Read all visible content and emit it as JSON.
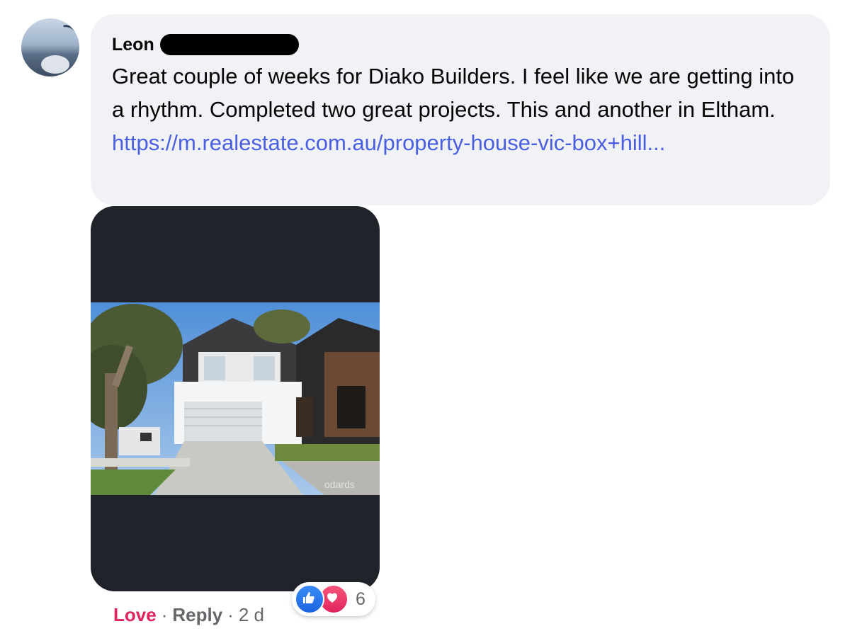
{
  "comment": {
    "author": "Leon",
    "text": "Great couple of weeks for Diako Builders. I feel like we are getting into a rhythm. Completed two great projects. This and another in Eltham.",
    "link": "https://m.realestate.com.au/property-house-vic-box+hill...",
    "media_watermark": "odards"
  },
  "actions": {
    "love": "Love",
    "separator": "·",
    "reply": "Reply",
    "time": "2 d"
  },
  "reactions": {
    "icons": [
      "like-icon",
      "love-icon"
    ],
    "count": "6"
  },
  "colors": {
    "bubble": "#f0f2f5",
    "link": "#4a5ee0",
    "love": "#e0245e",
    "like": "#1a64e0"
  }
}
